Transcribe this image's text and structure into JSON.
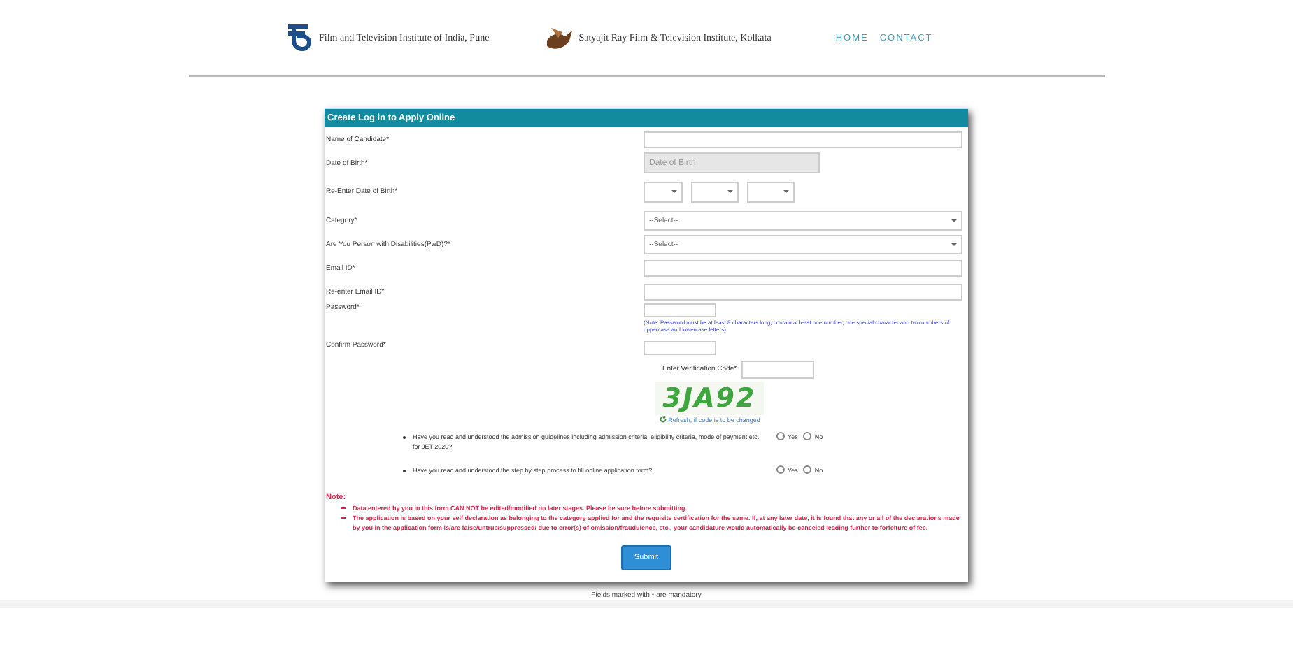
{
  "header": {
    "institutes": [
      {
        "name": "Film and Television Institute of India, Pune"
      },
      {
        "name": "Satyajit Ray Film & Television Institute, Kolkata"
      }
    ],
    "nav": [
      "HOME",
      "CONTACT"
    ]
  },
  "form": {
    "title": "Create Log in to Apply Online",
    "fields": [
      {
        "kind": "text",
        "label": "Name of Candidate*"
      },
      {
        "kind": "date",
        "label": "Date of Birth*",
        "placeholder": "Date of Birth"
      },
      {
        "kind": "date-selects",
        "label": "Re-Enter Date of Birth*"
      },
      {
        "kind": "select",
        "label": "Category*",
        "value": "--Select--"
      },
      {
        "kind": "select",
        "label": "Are You Person with Disabilities(PwD)?*",
        "value": "--Select--"
      },
      {
        "kind": "text",
        "label": "Email ID*"
      },
      {
        "kind": "text",
        "label": "Re-enter Email ID*"
      },
      {
        "kind": "password",
        "label": "Password*",
        "note": "(Note: Password must be at least 8 characters long, contain at least one number, one special character and two numbers of uppercase and lowercase letters)"
      },
      {
        "kind": "short",
        "label": "Confirm Password*"
      }
    ],
    "verification": {
      "label": "Enter Verification Code*",
      "captcha": "3JA92",
      "refresh": "Refresh, if code is to be changed"
    },
    "questions": [
      {
        "text": "Have you read and understood the admission guidelines including admission criteria, eligibility criteria, mode of payment etc. for JET 2020?",
        "options": [
          {
            "label": "Yes",
            "selected": false
          },
          {
            "label": "No",
            "selected": false
          }
        ]
      },
      {
        "text": "Have you read and understood the step by step process to fill online application form?",
        "options": [
          {
            "label": "Yes",
            "selected": false
          },
          {
            "label": "No",
            "selected": false
          }
        ]
      }
    ],
    "note_heading": "Note:",
    "notes": [
      "Data entered by you in this form CAN NOT be edited/modified on later stages. Please be sure before submitting.",
      "The application is based on your self declaration as belonging to the category applied for and the requisite certification for the same. If, at any later date, it is found that any or all of the declarations made by you in the application form is/are false/untrue/suppressed/ due to error(s) of omission/fraudulence, etc., your candidature would automatically be canceled leading further to forfeiture of fee."
    ],
    "submit": "Submit"
  },
  "footer": "Fields marked with * are mandatory"
}
